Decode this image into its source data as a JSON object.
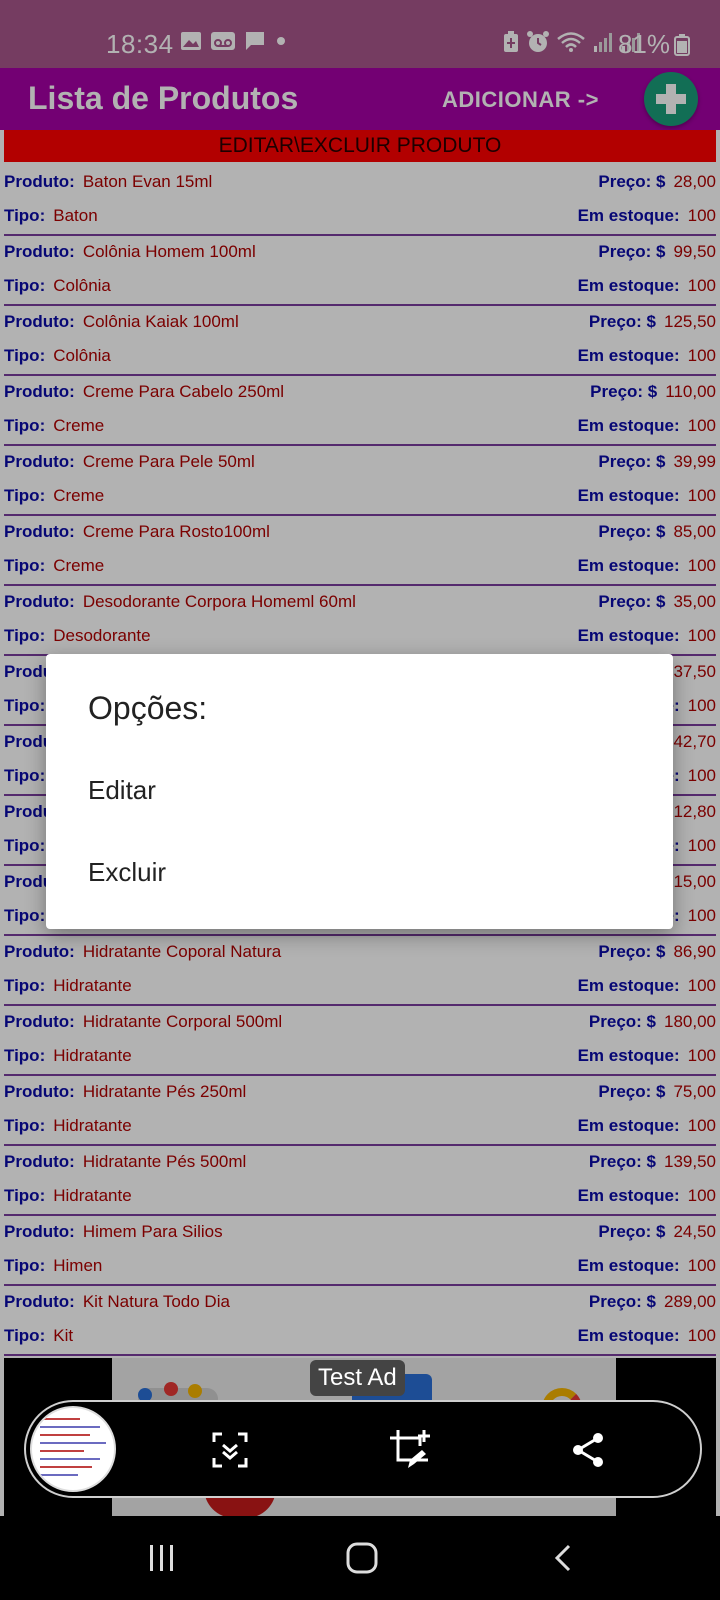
{
  "status_bar": {
    "time": "18:34",
    "battery": "81%",
    "icons_left": [
      "gallery-icon",
      "voicemail-icon",
      "message-icon",
      "dot-icon"
    ],
    "icons_right": [
      "battery-saver-icon",
      "alarm-icon",
      "wifi-icon",
      "signal-icon",
      "signal-icon",
      "battery-icon"
    ]
  },
  "app_bar": {
    "title": "Lista de Produtos",
    "add_label": "ADICIONAR ->",
    "colors": {
      "status": "#a8578c",
      "bar": "#a500a5",
      "fab": "#1a9e7a"
    }
  },
  "section_header": "EDITAR\\EXCLUIR PRODUTO",
  "labels": {
    "produto": "Produto:",
    "tipo": "Tipo:",
    "preco": "Preço: $",
    "estoque": "Em estoque:"
  },
  "products": [
    {
      "name": "Baton Evan 15ml",
      "type": "Baton",
      "price": "28,00",
      "stock": "100"
    },
    {
      "name": "Colônia Homem 100ml",
      "type": "Colônia",
      "price": "99,50",
      "stock": "100"
    },
    {
      "name": "Colônia Kaiak 100ml",
      "type": "Colônia",
      "price": "125,50",
      "stock": "100"
    },
    {
      "name": "Creme Para Cabelo 250ml",
      "type": "Creme",
      "price": "110,00",
      "stock": "100"
    },
    {
      "name": "Creme Para Pele 50ml",
      "type": "Creme",
      "price": "39,99",
      "stock": "100"
    },
    {
      "name": "Creme Para Rosto100ml",
      "type": "Creme",
      "price": "85,00",
      "stock": "100"
    },
    {
      "name": "Desodorante Corpora Homeml 60ml",
      "type": "Desodorante",
      "price": "35,00",
      "stock": "100"
    },
    {
      "name": "",
      "type": "",
      "price": "37,50",
      "stock": "100"
    },
    {
      "name": "",
      "type": "",
      "price": "42,70",
      "stock": "100"
    },
    {
      "name": "",
      "type": "",
      "price": "12,80",
      "stock": "100"
    },
    {
      "name": "",
      "type": "",
      "price": "15,00",
      "stock": "100"
    },
    {
      "name": "Hidratante Coporal Natura",
      "type": "Hidratante",
      "price": "86,90",
      "stock": "100"
    },
    {
      "name": "Hidratante Corporal 500ml",
      "type": "Hidratante",
      "price": "180,00",
      "stock": "100"
    },
    {
      "name": "Hidratante Pés 250ml",
      "type": "Hidratante",
      "price": "75,00",
      "stock": "100"
    },
    {
      "name": "Hidratante Pés 500ml",
      "type": "Hidratante",
      "price": "139,50",
      "stock": "100"
    },
    {
      "name": "Himem Para Silios",
      "type": "Himen",
      "price": "24,50",
      "stock": "100"
    },
    {
      "name": "Kit Natura Todo Dia",
      "type": "Kit",
      "price": "289,00",
      "stock": "100"
    }
  ],
  "dialog": {
    "title": "Opções:",
    "options": [
      "Editar",
      "Excluir"
    ]
  },
  "ad": {
    "label": "Test Ad"
  },
  "screenshot_toolbar": {
    "icons": [
      "scroll-capture-icon",
      "crop-edit-icon",
      "share-icon"
    ]
  },
  "nav_bar": {
    "icons": [
      "recents-icon",
      "home-icon",
      "back-icon"
    ]
  }
}
